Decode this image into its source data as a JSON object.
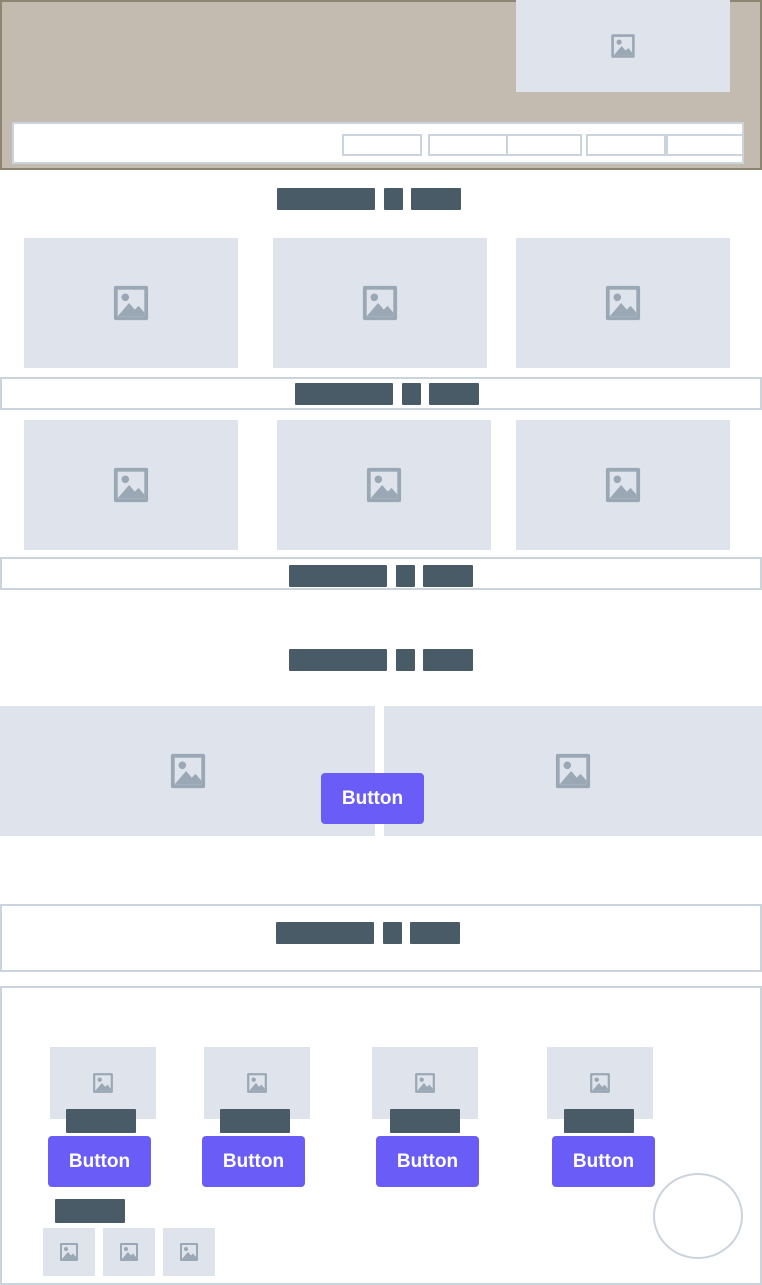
{
  "header": {
    "background": "#c3bbb0",
    "logo_icon": "image-placeholder-icon",
    "nav_items": [
      "",
      "",
      "",
      "",
      ""
    ]
  },
  "buttons": {
    "hero_cta_label": "Button",
    "card_labels": [
      "Button",
      "Button",
      "Button",
      "Button"
    ]
  },
  "colors": {
    "accent": "#6a5df7",
    "placeholder": "#dfe4ec",
    "icon": "#9aa7b4",
    "text_bar": "#4a5b68",
    "border": "#cbd3dc"
  },
  "icons": {
    "placeholder": "image-placeholder-icon",
    "floating_action": "circle-outline"
  }
}
